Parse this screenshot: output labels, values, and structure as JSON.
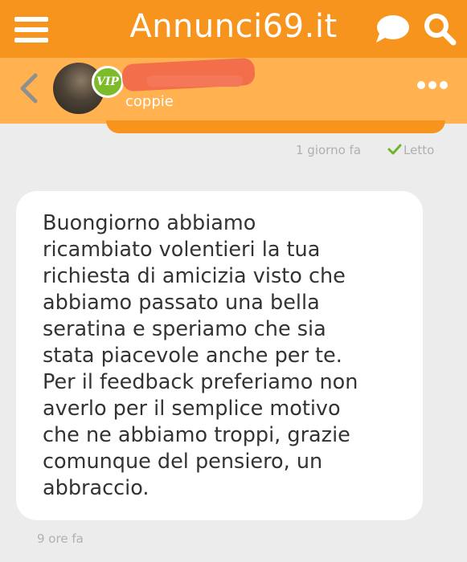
{
  "app": {
    "logo": "Annunci69.it"
  },
  "icons": {
    "menu": "hamburger-menu-icon",
    "chat": "chat-bubble-icon",
    "search": "search-icon",
    "back": "chevron-left-icon",
    "more": "more-dots-icon",
    "read": "check-icon"
  },
  "colors": {
    "brand": "#f7941d",
    "header_light": "#ffb24f",
    "vip": "#7dbb2a",
    "read_check": "#6fb52c"
  },
  "profile": {
    "badge": "VIP",
    "category": "coppie"
  },
  "sent_message": {
    "time": "1 giorno fa",
    "status": "Letto"
  },
  "received_message": {
    "text": "Buongiorno abbiamo\nricambiato volentieri la tua\nrichiesta di amicizia visto che\nabbiamo passato una bella\nseratina e speriamo che sia\nstata piacevole anche per te.\nPer il feedback preferiamo non\naverlo per il semplice motivo\nche ne abbiamo troppi, grazie\ncomunque del pensiero, un\nabbraccio.",
    "time": "9 ore fa"
  }
}
